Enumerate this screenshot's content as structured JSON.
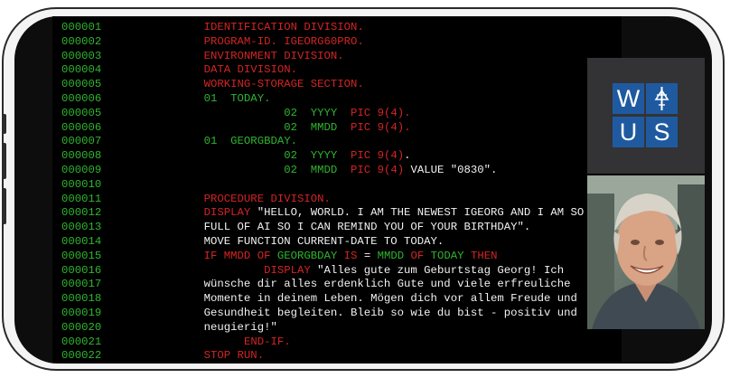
{
  "code_lines": [
    {
      "num": "000001",
      "segs": [
        {
          "t": "       "
        },
        {
          "t": "IDENTIFICATION DIVISION.",
          "c": "r"
        }
      ]
    },
    {
      "num": "000002",
      "segs": [
        {
          "t": "       "
        },
        {
          "t": "PROGRAM-ID. IGEORG60PRO.",
          "c": "r"
        }
      ]
    },
    {
      "num": "000003",
      "segs": [
        {
          "t": "       "
        },
        {
          "t": "ENVIRONMENT DIVISION.",
          "c": "r"
        }
      ]
    },
    {
      "num": "000004",
      "segs": [
        {
          "t": "       "
        },
        {
          "t": "DATA DIVISION.",
          "c": "r"
        }
      ]
    },
    {
      "num": "000005",
      "segs": [
        {
          "t": "       "
        },
        {
          "t": "WORKING-STORAGE SECTION.",
          "c": "r"
        }
      ]
    },
    {
      "num": "000006",
      "segs": [
        {
          "t": "       "
        },
        {
          "t": "01  TODAY.",
          "c": "g"
        }
      ]
    },
    {
      "num": "000005",
      "segs": [
        {
          "t": "                   "
        },
        {
          "t": "02  YYYY",
          "c": "g"
        },
        {
          "t": "  "
        },
        {
          "t": "PIC",
          "c": "r"
        },
        {
          "t": " "
        },
        {
          "t": "9(4).",
          "c": "r"
        }
      ]
    },
    {
      "num": "000006",
      "segs": [
        {
          "t": "                   "
        },
        {
          "t": "02  MMDD",
          "c": "g"
        },
        {
          "t": "  "
        },
        {
          "t": "PIC",
          "c": "r"
        },
        {
          "t": " "
        },
        {
          "t": "9(4).",
          "c": "r"
        }
      ]
    },
    {
      "num": "000007",
      "segs": [
        {
          "t": "       "
        },
        {
          "t": "01  GEORGBDAY.",
          "c": "g"
        }
      ]
    },
    {
      "num": "000008",
      "segs": [
        {
          "t": "                   "
        },
        {
          "t": "02  YYYY",
          "c": "g"
        },
        {
          "t": "  "
        },
        {
          "t": "PIC",
          "c": "r"
        },
        {
          "t": " "
        },
        {
          "t": "9(4)",
          "c": "r"
        },
        {
          "t": ".",
          "c": "w"
        }
      ]
    },
    {
      "num": "000009",
      "segs": [
        {
          "t": "                   "
        },
        {
          "t": "02  MMDD",
          "c": "g"
        },
        {
          "t": "  "
        },
        {
          "t": "PIC",
          "c": "r"
        },
        {
          "t": " "
        },
        {
          "t": "9(4)",
          "c": "r"
        },
        {
          "t": " VALUE \"0830\".",
          "c": "w"
        }
      ]
    },
    {
      "num": "000010",
      "segs": []
    },
    {
      "num": "000011",
      "segs": [
        {
          "t": "       "
        },
        {
          "t": "PROCEDURE DIVISION.",
          "c": "r"
        }
      ]
    },
    {
      "num": "000012",
      "segs": [
        {
          "t": "       "
        },
        {
          "t": "DISPLAY",
          "c": "r"
        },
        {
          "t": " \"HELLO, WORLD. I AM THE NEWEST IGEORG AND I AM SO",
          "c": "w"
        }
      ]
    },
    {
      "num": "000013",
      "segs": [
        {
          "t": "       "
        },
        {
          "t": "FULL OF AI SO I CAN REMIND YOU OF YOUR BIRTHDAY\".",
          "c": "w"
        }
      ]
    },
    {
      "num": "000014",
      "segs": [
        {
          "t": "       "
        },
        {
          "t": "MOVE FUNCTION CURRENT-DATE TO TODAY.",
          "c": "w"
        }
      ]
    },
    {
      "num": "000015",
      "segs": [
        {
          "t": "       "
        },
        {
          "t": "IF MMDD",
          "c": "r"
        },
        {
          "t": " "
        },
        {
          "t": "OF",
          "c": "r"
        },
        {
          "t": " "
        },
        {
          "t": "GEORGBDAY",
          "c": "g"
        },
        {
          "t": " "
        },
        {
          "t": "IS",
          "c": "r"
        },
        {
          "t": " = ",
          "c": "w"
        },
        {
          "t": "MMDD",
          "c": "g"
        },
        {
          "t": " "
        },
        {
          "t": "OF",
          "c": "r"
        },
        {
          "t": " "
        },
        {
          "t": "TODAY",
          "c": "g"
        },
        {
          "t": " "
        },
        {
          "t": "THEN",
          "c": "r"
        }
      ]
    },
    {
      "num": "000016",
      "segs": [
        {
          "t": "                "
        },
        {
          "t": "DISPLAY",
          "c": "r"
        },
        {
          "t": " \"Alles gute zum Geburtstag Georg! Ich",
          "c": "w"
        }
      ]
    },
    {
      "num": "000017",
      "segs": [
        {
          "t": "       "
        },
        {
          "t": "wünsche dir alles erdenklich Gute und viele erfreuliche",
          "c": "w"
        }
      ]
    },
    {
      "num": "000018",
      "segs": [
        {
          "t": "       "
        },
        {
          "t": "Momente in deinem Leben. Mögen dich vor allem Freude und",
          "c": "w"
        }
      ]
    },
    {
      "num": "000019",
      "segs": [
        {
          "t": "       "
        },
        {
          "t": "Gesundheit begleiten. Bleib so wie du bist - positiv und",
          "c": "w"
        }
      ]
    },
    {
      "num": "000020",
      "segs": [
        {
          "t": "       "
        },
        {
          "t": "neugierig!\"",
          "c": "w"
        }
      ]
    },
    {
      "num": "000021",
      "segs": [
        {
          "t": "             "
        },
        {
          "t": "END-IF.",
          "c": "r"
        }
      ]
    },
    {
      "num": "000022",
      "segs": [
        {
          "t": "       "
        },
        {
          "t": "STOP RUN.",
          "c": "r"
        }
      ]
    }
  ],
  "logo": {
    "tiles": [
      "W",
      "",
      "U",
      "S"
    ]
  },
  "colors": {
    "keyword_red": "#d42424",
    "identifier_green": "#2fb52f",
    "text_white": "#f2f2f2",
    "logo_blue": "#1f5aa0"
  }
}
